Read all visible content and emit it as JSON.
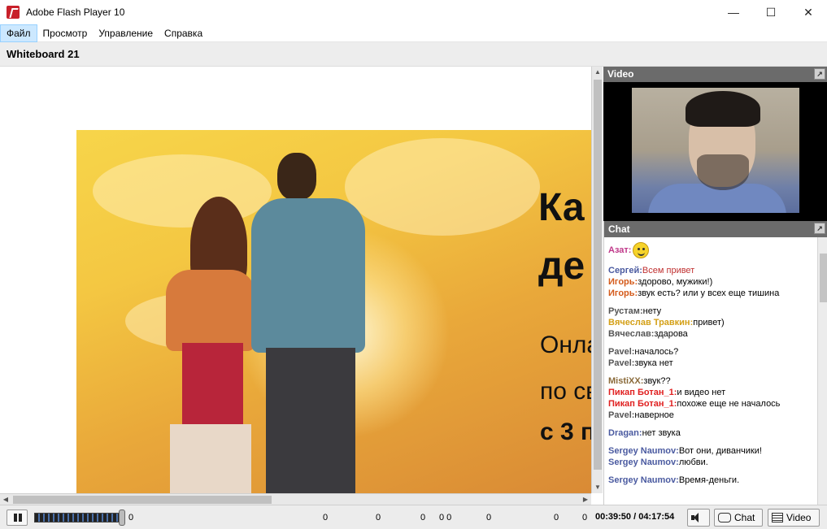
{
  "window": {
    "title": "Adobe Flash Player 10",
    "minimize": "—",
    "maximize": "☐",
    "close": "✕"
  },
  "menu": [
    {
      "label": "Файл",
      "active": true
    },
    {
      "label": "Просмотр"
    },
    {
      "label": "Управление"
    },
    {
      "label": "Справка"
    }
  ],
  "whiteboard": {
    "title": "Whiteboard 21",
    "slide_lines": [
      "Ка",
      "де",
      "Онла",
      "по св",
      "с 3 п"
    ]
  },
  "video_panel": {
    "title": "Video"
  },
  "chat_panel": {
    "title": "Chat",
    "messages": [
      {
        "nick": "Азат",
        "text": "",
        "color": "#c0398a",
        "smiley": true,
        "gap_after": true
      },
      {
        "nick": "Сергей",
        "text": "Всем привет",
        "color": "#4a5aa0",
        "text_color": "#c03030"
      },
      {
        "nick": "Игорь",
        "text": "здорово, мужики!)",
        "color": "#d45a1a"
      },
      {
        "nick": "Игорь",
        "text": "звук есть? или у всех еще тишина",
        "color": "#d45a1a",
        "gap_after": true
      },
      {
        "nick": "Рустам",
        "text": "нету",
        "color": "#555555"
      },
      {
        "nick": "Вячеслав Травкин",
        "text": "привет)",
        "color": "#d4a017"
      },
      {
        "nick": "Вячеслав",
        "text": "здарова",
        "color": "#555555",
        "gap_after": true
      },
      {
        "nick": "Pavel",
        "text": "началось?",
        "color": "#555555"
      },
      {
        "nick": "Pavel",
        "text": "звука нет",
        "color": "#555555",
        "gap_after": true
      },
      {
        "nick": "MistiXX",
        "text": "звук??",
        "color": "#8a6a3a"
      },
      {
        "nick": "Пикап Ботан_1",
        "text": "и видео нет",
        "color": "#e02020"
      },
      {
        "nick": "Пикап Ботан_1",
        "text": "похоже еще не началось",
        "color": "#e02020"
      },
      {
        "nick": "Pavel",
        "text": "наверное",
        "color": "#555555",
        "gap_after": true
      },
      {
        "nick": "Dragan",
        "text": "нет звука",
        "color": "#4a5aa0",
        "gap_after": true
      },
      {
        "nick": "Sergey Naumov",
        "text": "Вот они, диванчики!",
        "color": "#4a5aa0"
      },
      {
        "nick": "Sergey Naumov",
        "text": "любви.",
        "color": "#4a5aa0",
        "gap_after": true
      },
      {
        "nick": "Sergey Naumov",
        "text": "Время-деньги.",
        "color": "#4a5aa0"
      }
    ]
  },
  "controls": {
    "counters": [
      "0",
      "0",
      "0",
      "0",
      "0",
      "0 0",
      "0",
      "0",
      "0"
    ],
    "time": "00:39:50 / 04:17:54",
    "chat_label": "Chat",
    "video_label": "Video"
  }
}
